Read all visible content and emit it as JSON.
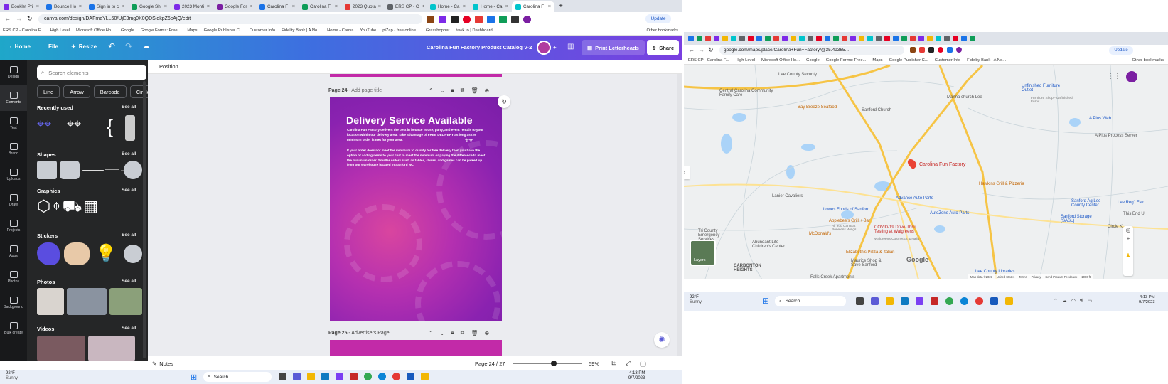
{
  "left_browser": {
    "tabs": [
      {
        "label": "Booklet Pri",
        "color": "#7d2ae8"
      },
      {
        "label": "Bounce Ho",
        "color": "#1a73e8"
      },
      {
        "label": "Sign in to c",
        "color": "#1a73e8"
      },
      {
        "label": "Google Sh",
        "color": "#0f9d58"
      },
      {
        "label": "2023 Monti",
        "color": "#7d2ae8"
      },
      {
        "label": "Google For",
        "color": "#7b1fa2"
      },
      {
        "label": "Carolina F",
        "color": "#1a73e8"
      },
      {
        "label": "Carolina F",
        "color": "#0f9d58"
      },
      {
        "label": "2023 Quota",
        "color": "#e53935"
      },
      {
        "label": "ERS CP - C",
        "color": "#5f6368"
      },
      {
        "label": "Home - Ca",
        "color": "#00c4cc"
      },
      {
        "label": "Home - Ca",
        "color": "#00c4cc"
      },
      {
        "label": "Carolina F",
        "color": "#00c4cc",
        "active": true
      }
    ],
    "url": "canva.com/design/DAFmaYLL60/UjE3mg0X0QDSiqkpZ6cAjQ/edit",
    "update_label": "Update",
    "bookmarks": [
      "ERS CP - Carolina F...",
      "High Level",
      "Microsoft Office Ho...",
      "Google",
      "Google Forms: Free...",
      "Maps",
      "Google Publisher C...",
      "Customer Info",
      "Fidelity Bank | A No...",
      "Home - Canva",
      "YouTube",
      "piZap - free online...",
      "Grasshopper",
      "tawk.to | Dashboard"
    ],
    "other_bookmarks": "Other bookmarks"
  },
  "canva": {
    "toolbar": {
      "home": "Home",
      "file": "File",
      "resize": "Resize",
      "doc_title": "Carolina Fun Factory Product Catalog V-2",
      "print": "Print Letterheads",
      "share": "Share"
    },
    "rail": [
      "Design",
      "Elements",
      "Text",
      "Brand",
      "Uploads",
      "Draw",
      "Projects",
      "Apps",
      "Photos",
      "Background",
      "Bulk create"
    ],
    "panel": {
      "search_placeholder": "Search elements",
      "chips": [
        "Line",
        "Arrow",
        "Barcode",
        "Circle"
      ],
      "sections": [
        {
          "title": "Recently used",
          "see_all": "See all"
        },
        {
          "title": "Shapes",
          "see_all": "See all"
        },
        {
          "title": "Graphics",
          "see_all": "See all"
        },
        {
          "title": "Stickers",
          "see_all": "See all"
        },
        {
          "title": "Photos",
          "see_all": "See all"
        },
        {
          "title": "Videos",
          "see_all": "See all"
        }
      ]
    },
    "position_label": "Position",
    "page24": {
      "header": "Page 24",
      "add_title": "- Add page title",
      "heading": "Delivery Service Available",
      "para1": "Carolina Fun Factory delivers the best in bounce house, party, and event rentals to your location within our delivery area. Take advantage of FREE DELIVERY as long as the minimum order is met for your area.",
      "para2": "If your order does not meet the minimum to qualify for free delivery then you have the option of adding items to your cart to meet the minimum or paying the difference to meet the minimum order.  Smaller orders such as tables, chairs, and games can be picked up from our warehouse located in Sanford NC."
    },
    "page25": {
      "header": "Page 25",
      "add_title": "- Advertisers Page"
    },
    "status": {
      "notes": "Notes",
      "page_counter": "Page 24 / 27",
      "zoom": "59%",
      "zoom_level": 0.59
    }
  },
  "left_taskbar": {
    "temp": "92°F",
    "weather": "Sunny",
    "search": "Search",
    "time": "4:13 PM",
    "date": "9/7/2023"
  },
  "right_browser": {
    "url": "google.com/maps/place/Carolina+Fun+Factory/@35.49365...",
    "update_label": "Update",
    "bookmarks": [
      "ERS CP - Carolina F...",
      "High Level",
      "Microsoft Office Ho...",
      "Google",
      "Google Forms: Free...",
      "Maps",
      "Google Publisher C...",
      "Customer Info",
      "Fidelity Bank | A No..."
    ],
    "other_bookmarks": "Other bookmarks"
  },
  "map": {
    "labels": {
      "lee_security": "Lee County Security",
      "central_carolina": "Central Carolina Community Family Care",
      "bay_breeze": "Bay Breeze Seafood",
      "sanford_church": "Sanford Church",
      "manna_church": "Manna church Lee",
      "unfinished": "Unfinished Furniture Outlet",
      "unfinished_sub": "Furniture Shop - Unfinished Furnit...",
      "a_plus_web": "A Plus Web",
      "a_plus_process": "A Plus Process Server",
      "carolina_fun_factory": "Carolina Fun Factory",
      "hawkins": "Hawkins Grill & Pizzeria",
      "advance_auto": "Advance Auto Parts",
      "lanier": "Lanier Cavaliers",
      "lowes": "Lowes Foods of Sanford",
      "autozone": "AutoZone Auto Parts",
      "applebees": "Applebee's Grill + Bar",
      "applebees_sub": "All You Can Eat Boneless Wings",
      "walgreens": "COVID-19 Drive-Thru Testing at Walgreens",
      "walgreens_sub": "Walgreens Cosmetics & Nails",
      "mcdonalds": "McDonald's",
      "tri_county": "Tri County Emergency Services",
      "abundant": "Abundant Life Children's Center",
      "elizabeths": "Elizabeth's Pizza & Italian",
      "maurice": "Maurice Shop & Save Sanford",
      "carbonton": "CARBONTON HEIGHTS",
      "falls_creek": "Falls Creek Apartments",
      "lee_libraries": "Lee County Libraries",
      "sanford_ag": "Sanford Ag Lee County Center",
      "lee_reg": "Lee Reg'l Fair",
      "sanford_storage": "Sanford Storage (SASL)",
      "this_end": "This End U",
      "circle_k": "Circle K",
      "google": "Google",
      "layers": "Layers"
    },
    "footer": [
      "Map data ©2023",
      "United States",
      "Terms",
      "Privacy",
      "Send Product Feedback",
      "1000 ft"
    ]
  },
  "right_taskbar": {
    "temp": "92°F",
    "weather": "Sunny",
    "search": "Search",
    "time": "4:13 PM",
    "date": "9/7/2023"
  },
  "colors": {
    "canva_gradient_start": "#1fa7c9",
    "canva_gradient_end": "#7a3fe0",
    "page_magenta": "#b530b0",
    "map_pin": "#ea4335"
  }
}
